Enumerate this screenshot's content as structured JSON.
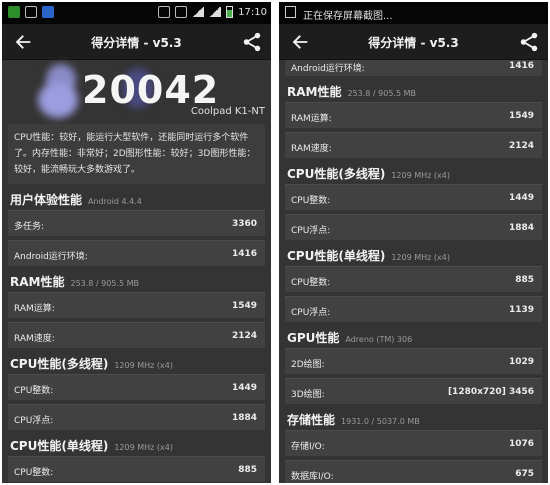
{
  "left": {
    "status": {
      "time": "17:10"
    },
    "appbar": {
      "title": "得分详情 - v5.3"
    },
    "score": "20042",
    "device": "Coolpad K1-NT",
    "description": "CPU性能：较好，能运行大型软件，还能同时运行多个软件了。内存性能：非常好；2D图形性能：较好；3D图形性能：较好，能流畅玩大多数游戏了。",
    "sections": [
      {
        "title": "用户体验性能",
        "subtitle": "Android 4.4.4",
        "rows": [
          {
            "label": "多任务:",
            "value": "3360"
          },
          {
            "label": "Android运行环境:",
            "value": "1416"
          }
        ]
      },
      {
        "title": "RAM性能",
        "subtitle": "253.8 / 905.5 MB",
        "rows": [
          {
            "label": "RAM运算:",
            "value": "1549"
          },
          {
            "label": "RAM速度:",
            "value": "2124"
          }
        ]
      },
      {
        "title": "CPU性能(多线程)",
        "subtitle": "1209 MHz (x4)",
        "rows": [
          {
            "label": "CPU整数:",
            "value": "1449"
          },
          {
            "label": "CPU浮点:",
            "value": "1884"
          }
        ]
      },
      {
        "title": "CPU性能(单线程)",
        "subtitle": "1209 MHz (x4)",
        "rows": [
          {
            "label": "CPU整数:",
            "value": "885"
          }
        ]
      }
    ]
  },
  "right": {
    "status": {
      "saving_text": "正在保存屏幕截图..."
    },
    "appbar": {
      "title": "得分详情 - v5.3"
    },
    "top_row": {
      "label": "Android运行环境:",
      "value": "1416"
    },
    "sections": [
      {
        "title": "RAM性能",
        "subtitle": "253.8 / 905.5 MB",
        "rows": [
          {
            "label": "RAM运算:",
            "value": "1549"
          },
          {
            "label": "RAM速度:",
            "value": "2124"
          }
        ]
      },
      {
        "title": "CPU性能(多线程)",
        "subtitle": "1209 MHz (x4)",
        "rows": [
          {
            "label": "CPU整数:",
            "value": "1449"
          },
          {
            "label": "CPU浮点:",
            "value": "1884"
          }
        ]
      },
      {
        "title": "CPU性能(单线程)",
        "subtitle": "1209 MHz (x4)",
        "rows": [
          {
            "label": "CPU整数:",
            "value": "885"
          },
          {
            "label": "CPU浮点:",
            "value": "1139"
          }
        ]
      },
      {
        "title": "GPU性能",
        "subtitle": "Adreno (TM) 306",
        "rows": [
          {
            "label": "2D绘图:",
            "value": "1029"
          },
          {
            "label": "3D绘图:",
            "value": "[1280x720] 3456"
          }
        ]
      },
      {
        "title": "存储性能",
        "subtitle": "1931.0 / 5037.0 MB",
        "rows": [
          {
            "label": "存储I/O:",
            "value": "1076"
          },
          {
            "label": "数据库I/O:",
            "value": "675"
          }
        ]
      }
    ]
  }
}
